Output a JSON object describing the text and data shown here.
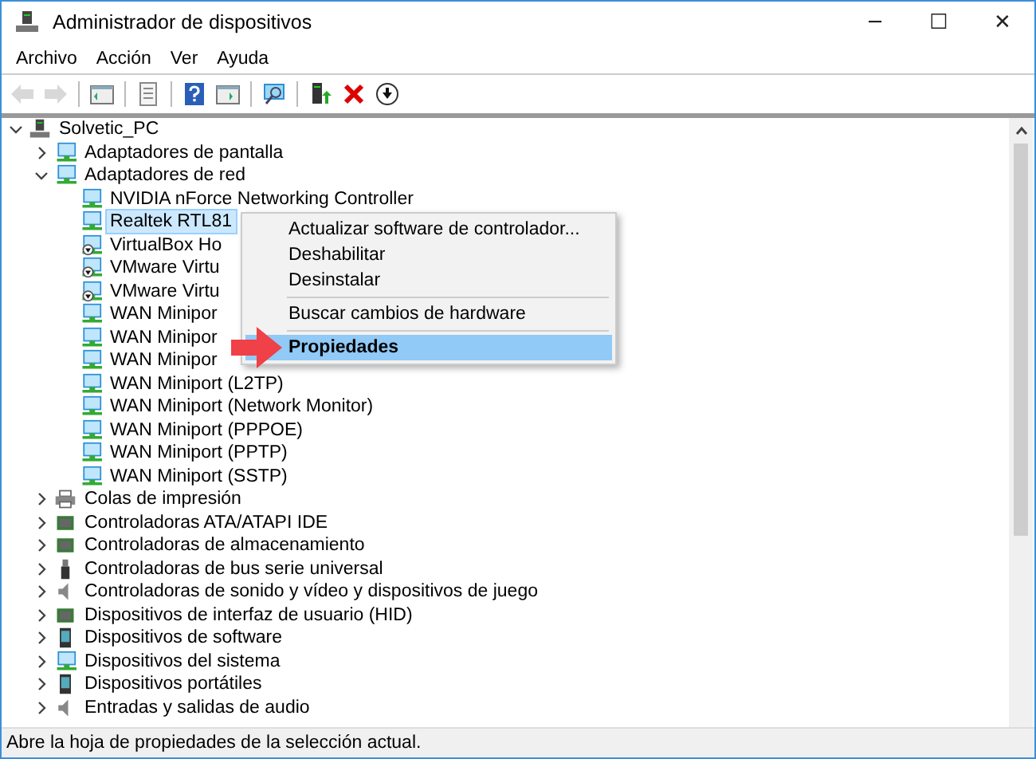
{
  "window": {
    "title": "Administrador de dispositivos",
    "controls": [
      "─",
      "☐",
      "✕"
    ]
  },
  "menu": [
    "Archivo",
    "Acción",
    "Ver",
    "Ayuda"
  ],
  "toolbar": [
    {
      "kind": "back",
      "disabled": true
    },
    {
      "kind": "forward",
      "disabled": true
    },
    {
      "kind": "sep"
    },
    {
      "kind": "tree",
      "disabled": false
    },
    {
      "kind": "sep"
    },
    {
      "kind": "props",
      "disabled": false
    },
    {
      "kind": "sep"
    },
    {
      "kind": "help",
      "disabled": false
    },
    {
      "kind": "pane",
      "disabled": false
    },
    {
      "kind": "sep"
    },
    {
      "kind": "scan",
      "disabled": false
    },
    {
      "kind": "sep"
    },
    {
      "kind": "update",
      "disabled": false
    },
    {
      "kind": "remove",
      "disabled": false
    },
    {
      "kind": "disable",
      "disabled": false
    }
  ],
  "tree": [
    {
      "label": "Solvetic_PC",
      "kind": "computer",
      "expanded": true,
      "children": [
        {
          "label": "Adaptadores de pantalla",
          "kind": "display",
          "expanded": false
        },
        {
          "label": "Adaptadores de red",
          "kind": "network",
          "expanded": true,
          "children": [
            {
              "label": "NVIDIA nForce Networking Controller",
              "kind": "network",
              "selected": false,
              "disabled": false
            },
            {
              "label": "Realtek RTL81",
              "kind": "network",
              "selected": true,
              "disabled": false
            },
            {
              "label": "VirtualBox Ho",
              "kind": "network",
              "selected": false,
              "disabled": true
            },
            {
              "label": "VMware Virtu",
              "kind": "network",
              "selected": false,
              "disabled": true
            },
            {
              "label": "VMware Virtu",
              "kind": "network",
              "selected": false,
              "disabled": true
            },
            {
              "label": "WAN Minipor",
              "kind": "network",
              "selected": false,
              "disabled": false
            },
            {
              "label": "WAN Minipor",
              "kind": "network",
              "selected": false,
              "disabled": false
            },
            {
              "label": "WAN Minipor",
              "kind": "network",
              "selected": false,
              "disabled": false
            },
            {
              "label": "WAN Miniport (L2TP)",
              "kind": "network",
              "selected": false,
              "disabled": false
            },
            {
              "label": "WAN Miniport (Network Monitor)",
              "kind": "network",
              "selected": false,
              "disabled": false
            },
            {
              "label": "WAN Miniport (PPPOE)",
              "kind": "network",
              "selected": false,
              "disabled": false
            },
            {
              "label": "WAN Miniport (PPTP)",
              "kind": "network",
              "selected": false,
              "disabled": false
            },
            {
              "label": "WAN Miniport (SSTP)",
              "kind": "network",
              "selected": false,
              "disabled": false
            }
          ]
        },
        {
          "label": "Colas de impresión",
          "kind": "printer",
          "expanded": false
        },
        {
          "label": "Controladoras ATA/ATAPI IDE",
          "kind": "chip",
          "expanded": false
        },
        {
          "label": "Controladoras de almacenamiento",
          "kind": "chip",
          "expanded": false
        },
        {
          "label": "Controladoras de bus serie universal",
          "kind": "usb",
          "expanded": false
        },
        {
          "label": "Controladoras de sonido y vídeo y dispositivos de juego",
          "kind": "sound",
          "expanded": false
        },
        {
          "label": "Dispositivos de interfaz de usuario (HID)",
          "kind": "chip",
          "expanded": false
        },
        {
          "label": "Dispositivos de software",
          "kind": "phone",
          "expanded": false
        },
        {
          "label": "Dispositivos del sistema",
          "kind": "display",
          "expanded": false
        },
        {
          "label": "Dispositivos portátiles",
          "kind": "phone",
          "expanded": false
        },
        {
          "label": "Entradas y salidas de audio",
          "kind": "sound",
          "expanded": false
        }
      ]
    }
  ],
  "context_menu": [
    {
      "kind": "item",
      "label": "Actualizar software de controlador...",
      "selected": false,
      "default": false
    },
    {
      "kind": "item",
      "label": "Deshabilitar",
      "selected": false,
      "default": false
    },
    {
      "kind": "item",
      "label": "Desinstalar",
      "selected": false,
      "default": false
    },
    {
      "kind": "separator"
    },
    {
      "kind": "item",
      "label": "Buscar cambios de hardware",
      "selected": false,
      "default": false
    },
    {
      "kind": "separator"
    },
    {
      "kind": "item",
      "label": "Propiedades",
      "selected": true,
      "default": true
    }
  ],
  "status_bar": "Abre la hoja de propiedades de la selección actual."
}
